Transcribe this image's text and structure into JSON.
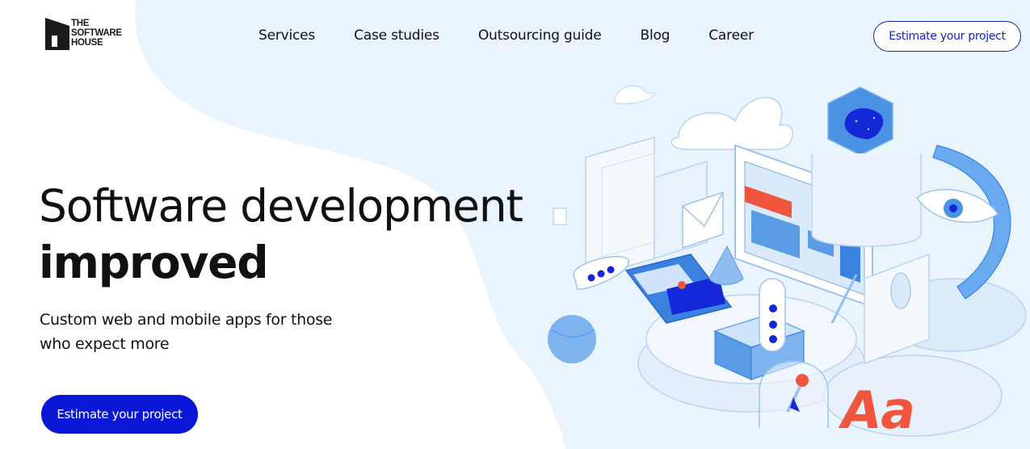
{
  "brand": {
    "logo_line1": "THE",
    "logo_line2": "SOFTWARE",
    "logo_line3": "HOUSE"
  },
  "nav": {
    "items": [
      {
        "label": "Services"
      },
      {
        "label": "Case studies"
      },
      {
        "label": "Outsourcing guide"
      },
      {
        "label": "Blog"
      },
      {
        "label": "Career"
      }
    ],
    "cta_label": "Estimate your project"
  },
  "hero": {
    "title_line1": "Software development",
    "title_line2": "improved",
    "subtitle_line1": "Custom web and mobile apps for those",
    "subtitle_line2": "who expect more",
    "cta_label": "Estimate your project"
  },
  "colors": {
    "accent": "#0a17d6",
    "background_blob": "#e8f3fd",
    "illustration_red": "#f0563e"
  },
  "icons": {
    "logo": "house-logo-icon"
  }
}
